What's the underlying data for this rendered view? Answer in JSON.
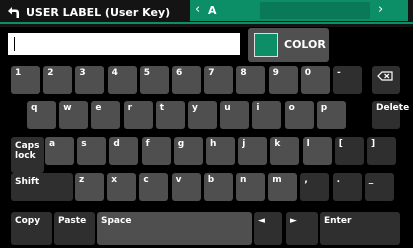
{
  "header": {
    "title": "USER LABEL (User Key)",
    "channel_name": "A",
    "prev_symbol": "‹",
    "next_symbol": "›"
  },
  "input": {
    "value": "",
    "placeholder": ""
  },
  "color_button": {
    "label": "COLOR",
    "swatch_color": "#0c8f66"
  },
  "accent_color": "#0c8f66",
  "keyboard": {
    "row1": [
      "1",
      "2",
      "3",
      "4",
      "5",
      "6",
      "7",
      "8",
      "9",
      "0",
      "-"
    ],
    "row2": [
      "q",
      "w",
      "e",
      "r",
      "t",
      "y",
      "u",
      "i",
      "o",
      "p"
    ],
    "row3": [
      "a",
      "s",
      "d",
      "f",
      "g",
      "h",
      "j",
      "k",
      "l",
      "[",
      "]"
    ],
    "row4": [
      "z",
      "x",
      "c",
      "v",
      "b",
      "n",
      "m",
      ",",
      ".",
      "_"
    ],
    "backspace_icon": "backspace-icon",
    "delete_label": "Delete",
    "caps_label": "Caps\nlock",
    "shift_label": "Shift",
    "copy_label": "Copy",
    "paste_label": "Paste",
    "space_label": "Space",
    "left_arrow": "◄",
    "right_arrow": "►",
    "enter_label": "Enter"
  }
}
